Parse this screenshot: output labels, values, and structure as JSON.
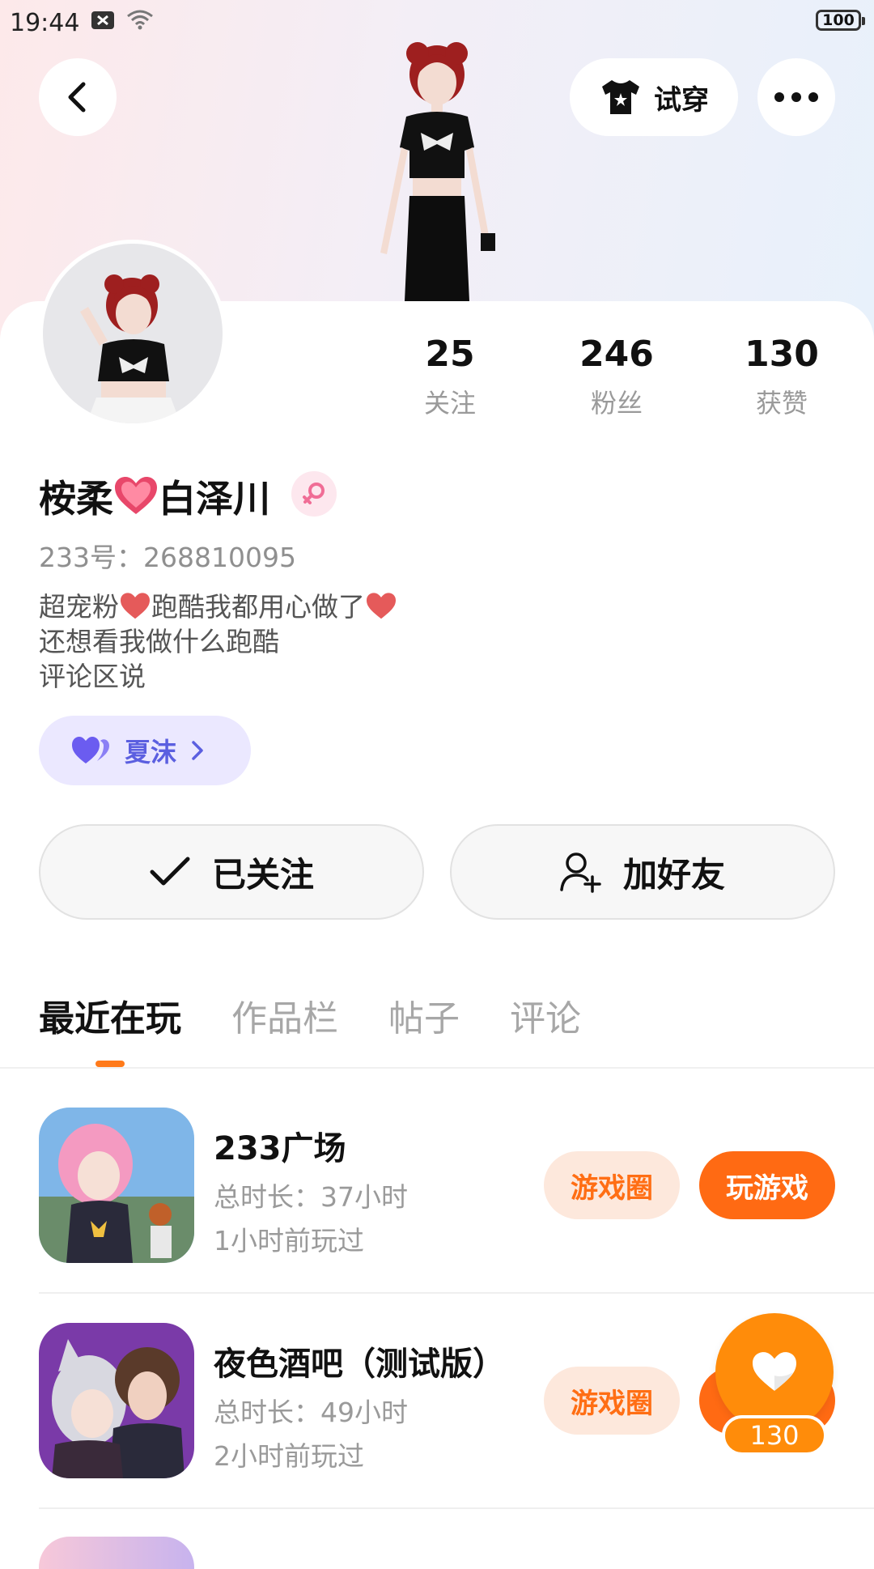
{
  "status_bar": {
    "time": "19:44",
    "battery": "100"
  },
  "header": {
    "try_on_label": "试穿"
  },
  "stats": [
    {
      "value": "25",
      "label": "关注"
    },
    {
      "value": "246",
      "label": "粉丝"
    },
    {
      "value": "130",
      "label": "获赞"
    }
  ],
  "profile": {
    "name_part1": "桉柔",
    "name_part2": "白泽川",
    "uid": "233号：268810095",
    "bio_line1_a": "超宠粉",
    "bio_line1_b": "跑酷我都用心做了",
    "bio_line2": "还想看我做什么跑酷",
    "bio_line3": "评论区说",
    "relation_name": "夏沫"
  },
  "actions": {
    "followed_label": "已关注",
    "add_friend_label": "加好友"
  },
  "tabs": [
    "最近在玩",
    "作品栏",
    "帖子",
    "评论"
  ],
  "games": [
    {
      "title": "233广场",
      "duration": "总时长：37小时",
      "last_played": "1小时前玩过",
      "circle_label": "游戏圈",
      "play_label": "玩游戏"
    },
    {
      "title": "夜色酒吧（测试版）",
      "duration": "总时长：49小时",
      "last_played": "2小时前玩过",
      "circle_label": "游戏圈"
    }
  ],
  "like_badge": {
    "count": "130"
  },
  "colors": {
    "accent": "#ff6a13",
    "relation_bg": "#ebe8ff",
    "relation_text": "#5b5fe0"
  }
}
